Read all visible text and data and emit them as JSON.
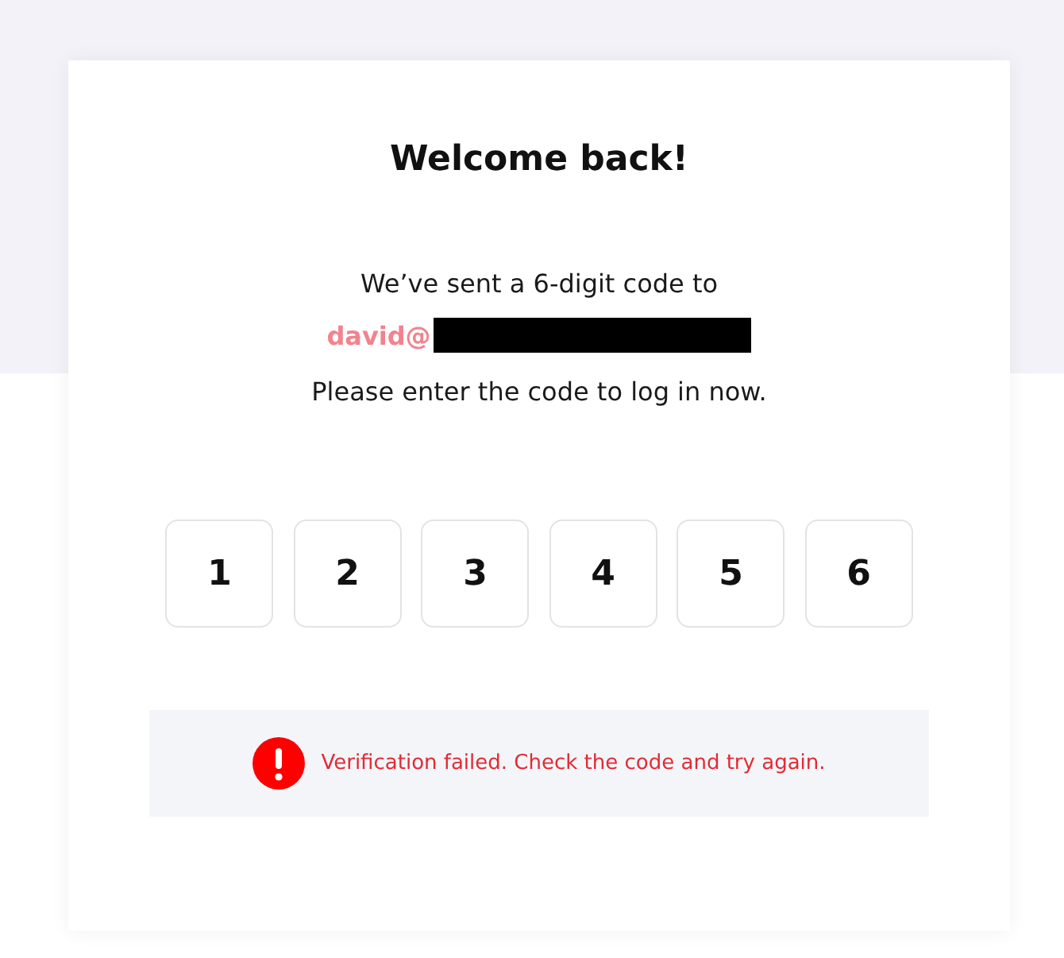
{
  "title": "Welcome back!",
  "message": {
    "line_1": "We’ve sent a 6-digit code to",
    "email": "david@",
    "email_redacted": true,
    "line_2": "Please enter the code to log in now."
  },
  "code_digits": [
    "1",
    "2",
    "3",
    "4",
    "5",
    "6"
  ],
  "alert": {
    "kind": "error",
    "text": "Verification failed. Check the code and try again."
  }
}
